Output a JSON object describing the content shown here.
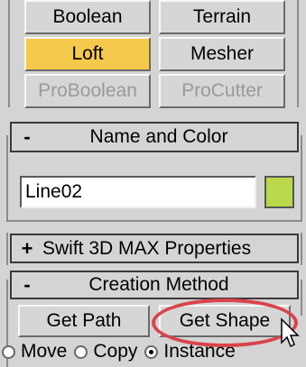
{
  "top_buttons": [
    {
      "label": "Boolean"
    },
    {
      "label": "Terrain"
    },
    {
      "label": "Loft"
    },
    {
      "label": "Mesher"
    },
    {
      "label": "ProBoolean"
    },
    {
      "label": "ProCutter"
    }
  ],
  "name_and_color": {
    "sign": "-",
    "title": "Name and Color",
    "name_value": "Line02",
    "color": "#b9d84a"
  },
  "swift_rollout": {
    "sign": "+",
    "title": "Swift 3D MAX Properties"
  },
  "creation_method": {
    "sign": "-",
    "title": "Creation Method",
    "get_path_label": "Get Path",
    "get_shape_label": "Get Shape",
    "options": [
      {
        "label": "Move",
        "selected": false
      },
      {
        "label": "Copy",
        "selected": false
      },
      {
        "label": "Instance",
        "selected": true
      }
    ]
  },
  "colors": {
    "active_button": "#f4c94c",
    "annotation": "#d9434b"
  }
}
